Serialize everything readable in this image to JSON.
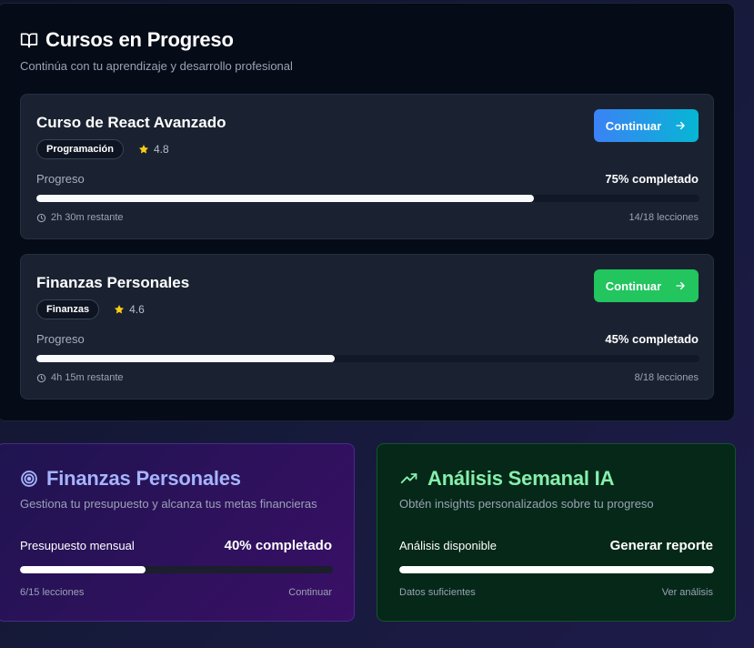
{
  "main": {
    "title": "Cursos en Progreso",
    "subtitle": "Continúa con tu aprendizaje y desarrollo profesional",
    "icon": "book-open-icon"
  },
  "courses": [
    {
      "title": "Curso de React Avanzado",
      "category": "Programación",
      "rating": "4.8",
      "button_label": "Continuar",
      "button_color": "#3b82f6",
      "progress_label": "Progreso",
      "progress_text": "75% completado",
      "progress_value": 0.75,
      "time_left": "2h 30m restante",
      "lessons": "14/18 lecciones"
    },
    {
      "title": "Finanzas Personales",
      "category": "Finanzas",
      "rating": "4.6",
      "button_label": "Continuar",
      "button_color": "#22c55e",
      "progress_label": "Progreso",
      "progress_text": "45% completado",
      "progress_value": 0.45,
      "time_left": "4h 15m restante",
      "lessons": "8/18 lecciones"
    }
  ],
  "finance_card": {
    "icon": "target-icon",
    "title": "Finanzas Personales",
    "subtitle": "Gestiona tu presupuesto y alcanza tus metas financieras",
    "label": "Presupuesto mensual",
    "value": "40% completado",
    "progress_value": 0.4,
    "foot_left": "6/15 lecciones",
    "foot_right": "Continuar",
    "accent": "#a5b4fc"
  },
  "analysis_card": {
    "icon": "trending-up-icon",
    "title": "Análisis Semanal IA",
    "subtitle": "Obtén insights personalizados sobre tu progreso",
    "label": "Análisis disponible",
    "value": "Generar reporte",
    "progress_value": 1.0,
    "foot_left": "Datos suficientes",
    "foot_right": "Ver análisis",
    "accent": "#86efac"
  }
}
